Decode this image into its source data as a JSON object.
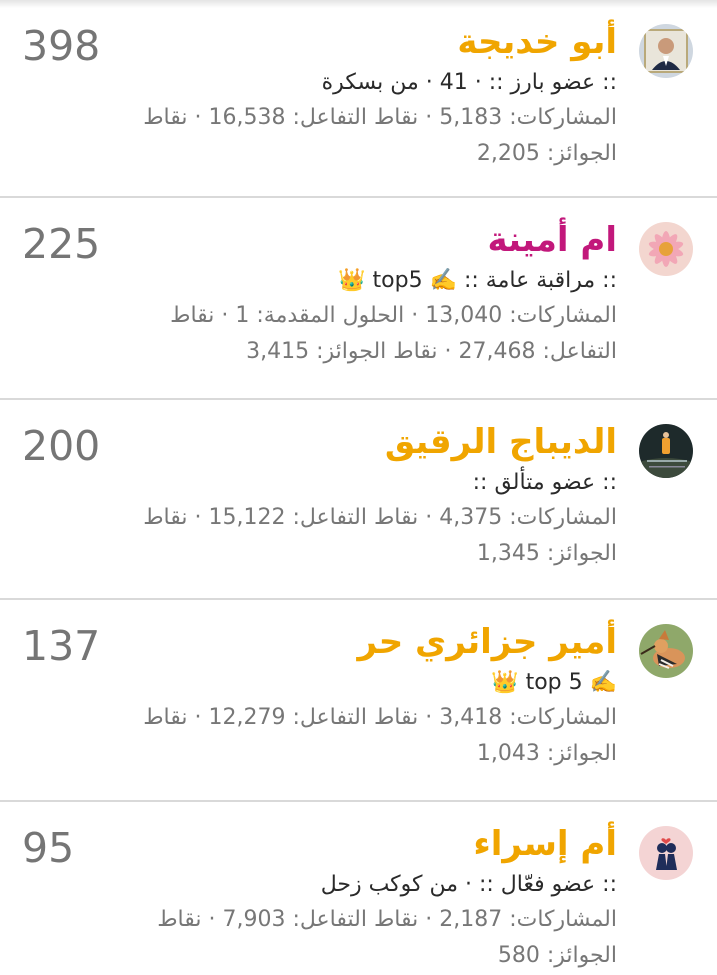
{
  "colors": {
    "name_gold": "#f0a500",
    "name_pink": "#c2187b",
    "points_gray": "#757575",
    "divider": "#d9d9d9"
  },
  "members": [
    {
      "name": "أبو خديجة",
      "name_color": "#f0a500",
      "points": "398",
      "title": ":: عضو بارز :: · 41 · من بسكرة",
      "stats": "المشاركات: 5,183 · نقاط التفاعل: 16,538 · نقاط الجوائز: 2,205",
      "avatar_icon": "man-portrait-avatar"
    },
    {
      "name": "ام أمينة",
      "name_color": "#c2187b",
      "points": "225",
      "title": ":: مراقبة عامة :: ✍️ top5 👑",
      "stats": "المشاركات: 13,040 · الحلول المقدمة: 1 · نقاط التفاعل: 27,468 · نقاط الجوائز: 3,415",
      "avatar_icon": "pink-flower-avatar"
    },
    {
      "name": "الديباج الرقيق",
      "name_color": "#f0a500",
      "points": "200",
      "title": ":: عضو متألق ::",
      "stats": "المشاركات: 4,375 · نقاط التفاعل: 15,122 · نقاط الجوائز: 1,345",
      "avatar_icon": "night-road-avatar"
    },
    {
      "name": "أمير جزائري حر",
      "name_color": "#f0a500",
      "points": "137",
      "title": "✍️ top 5 👑",
      "stats": "المشاركات: 3,418 · نقاط التفاعل: 12,279 · نقاط الجوائز: 1,043",
      "avatar_icon": "hoopoe-bird-avatar"
    },
    {
      "name": "أم إسراء",
      "name_color": "#f0a500",
      "points": "95",
      "title": ":: عضو فعّال :: · من كوكب زحل",
      "stats": "المشاركات: 2,187 · نقاط التفاعل: 7,903 · نقاط الجوائز: 580",
      "avatar_icon": "couple-silhouette-avatar"
    }
  ]
}
